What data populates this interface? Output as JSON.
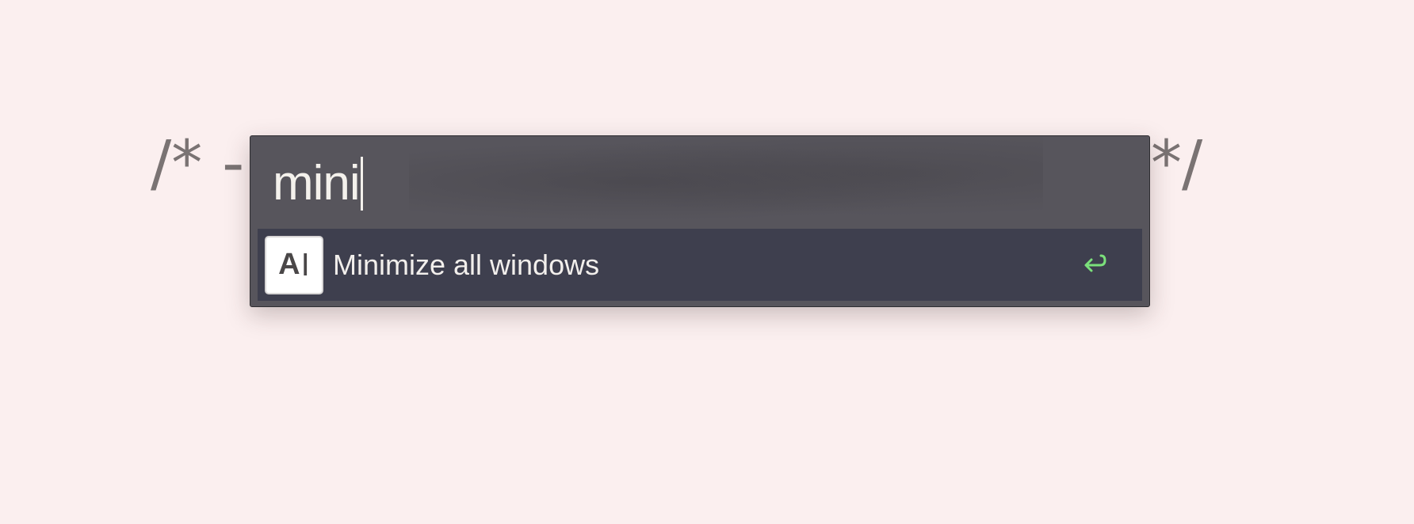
{
  "background": {
    "comment_left": "/* -",
    "comment_right": "*/",
    "color": "#fbefef"
  },
  "palette": {
    "query": "mini",
    "results": [
      {
        "icon": "text-cursor-icon",
        "icon_letter": "A",
        "icon_cursor": "I",
        "label": "Minimize all windows",
        "action_icon": "enter-return-icon",
        "action_color": "#7be07b"
      }
    ]
  }
}
